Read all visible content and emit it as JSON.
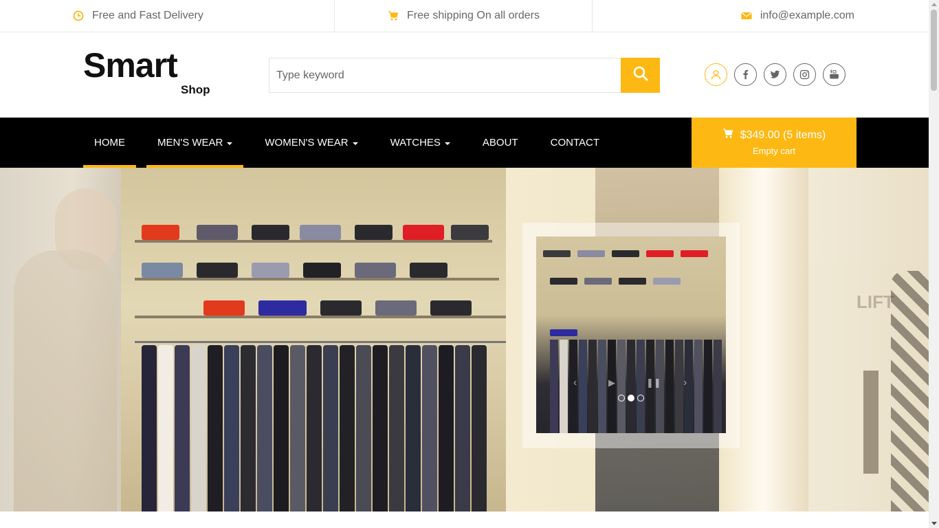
{
  "topbar": {
    "delivery_text": "Free and Fast Delivery",
    "shipping_text": "Free shipping On all orders",
    "email_text": "info@example.com",
    "delivery_icon": "clock-icon",
    "shipping_icon": "cart-icon",
    "email_icon": "envelope-icon"
  },
  "header": {
    "logo_main": "Smart",
    "logo_sub": "Shop",
    "search": {
      "placeholder": "Type keyword",
      "value": ""
    },
    "social": [
      "user-icon",
      "facebook-icon",
      "twitter-icon",
      "instagram-icon",
      "youtube-icon"
    ]
  },
  "nav": {
    "items": [
      {
        "label": "HOME",
        "dropdown": false,
        "active": true
      },
      {
        "label": "MEN'S WEAR",
        "dropdown": true,
        "active": true
      },
      {
        "label": "WOMEN'S WEAR",
        "dropdown": true,
        "active": false
      },
      {
        "label": "WATCHES",
        "dropdown": true,
        "active": false
      },
      {
        "label": "ABOUT",
        "dropdown": false,
        "active": false
      },
      {
        "label": "CONTACT",
        "dropdown": false,
        "active": false
      }
    ],
    "cart": {
      "summary": "$349.00 (5 items)",
      "action": "Empty cart"
    }
  },
  "slider": {
    "slides": 3,
    "current": 2
  },
  "colors": {
    "accent": "#fdb813",
    "nav_bg": "#000000",
    "text_muted": "#666666"
  }
}
